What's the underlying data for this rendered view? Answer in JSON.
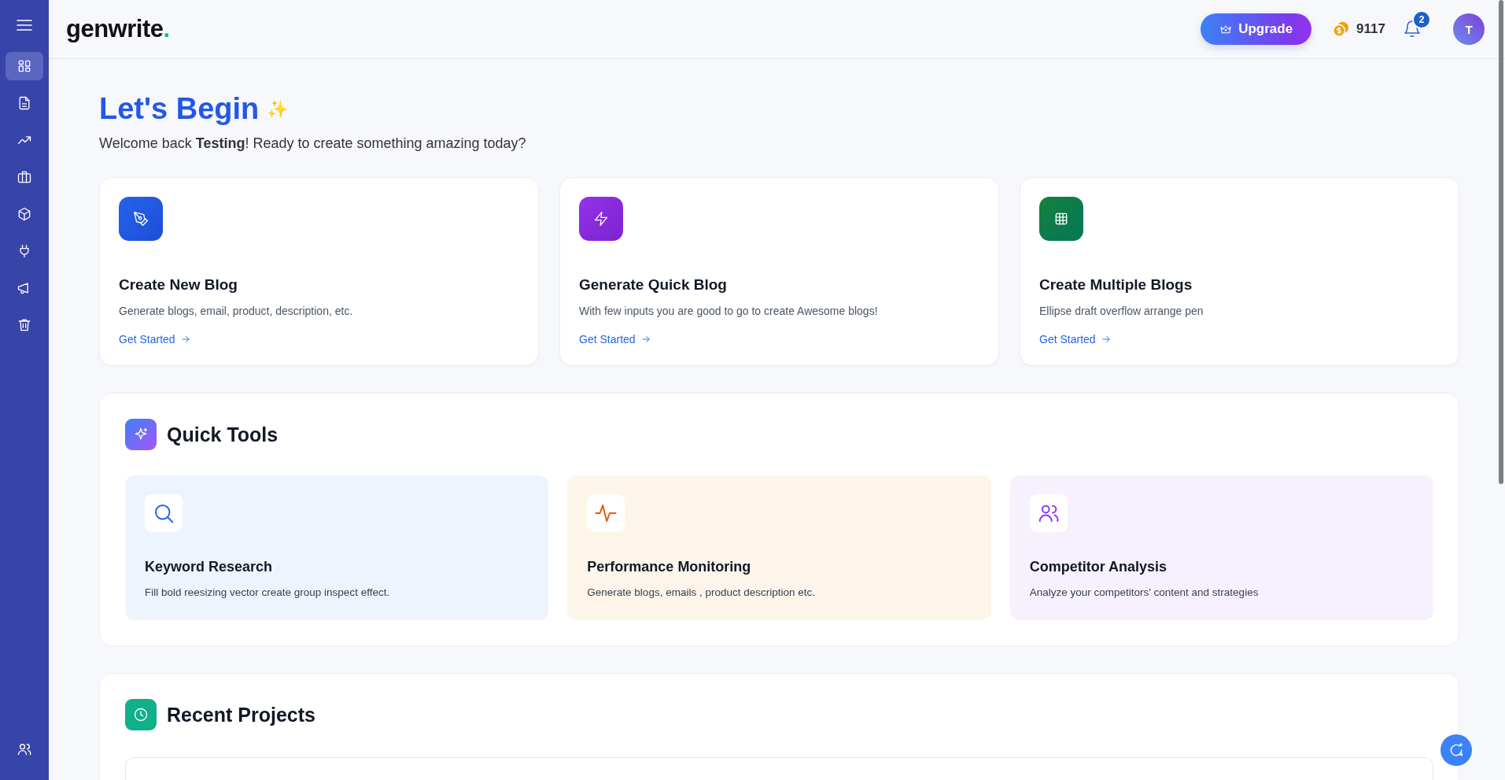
{
  "sidebar": {
    "items": [
      {
        "selected": true
      },
      {
        "selected": false
      },
      {
        "selected": false
      },
      {
        "selected": false
      },
      {
        "selected": false
      },
      {
        "selected": false
      },
      {
        "selected": false
      },
      {
        "selected": false
      }
    ],
    "bottom_items": [
      {
        "selected": false
      }
    ]
  },
  "header": {
    "logo": {
      "name": "genwrite",
      "mark": "."
    },
    "upgrade_button": "Upgrade",
    "credits": "9117",
    "notifications_badge": "2",
    "avatar_initial": "T"
  },
  "hero": {
    "title": "Let's Begin",
    "title_mark": "✨",
    "subtitle": "Welcome back **Testing**! Ready to create something amazing today?"
  },
  "action_cards": [
    {
      "title": "Create New Blog",
      "description": "Generate blogs, email, product, description, etc.",
      "link": "Get Started"
    },
    {
      "title": "Generate Quick Blog",
      "description": "With few inputs you are good to go to create Awesome blogs!",
      "link": "Get Started"
    },
    {
      "title": "Create Multiple Blogs",
      "description": "Ellipse draft overflow arrange pen",
      "link": "Get Started"
    }
  ],
  "quick_tools": {
    "title": "Quick Tools",
    "tools": [
      {
        "title": "Keyword Research",
        "description": "Fill bold reesizing vector create group inspect effect."
      },
      {
        "title": "Performance Monitoring",
        "description": "Generate blogs, emails , product description etc."
      },
      {
        "title": "Competitor Analysis",
        "description": "Analyze your competitors' content and strategies"
      }
    ]
  },
  "recent_projects": {
    "title": "Recent Projects"
  }
}
